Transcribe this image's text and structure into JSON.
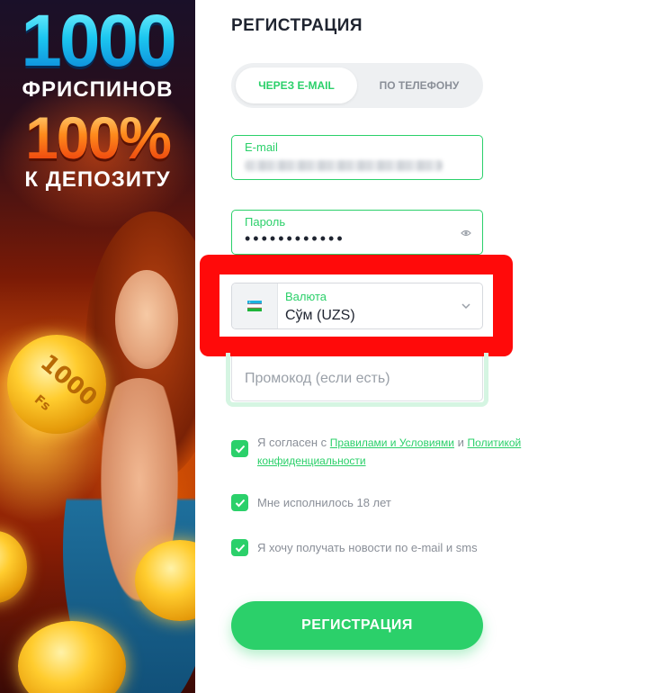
{
  "banner": {
    "line1": "1000",
    "line2": "ФРИСПИНОВ",
    "line3": "100%",
    "line4": "К ДЕПОЗИТУ",
    "coin_text": "1000",
    "coin_sub": "Fs"
  },
  "form": {
    "title": "РЕГИСТРАЦИЯ",
    "tabs": [
      {
        "label": "ЧЕРЕЗ E-MAIL",
        "active": true
      },
      {
        "label": "ПО ТЕЛЕФОНУ",
        "active": false
      }
    ],
    "email": {
      "label": "E-mail"
    },
    "password": {
      "label": "Пароль",
      "value": "••••••••••••"
    },
    "currency": {
      "label": "Валюта",
      "value": "Сўм (UZS)",
      "flag": "uzbekistan-flag-icon"
    },
    "promocode": {
      "placeholder": "Промокод (если есть)"
    },
    "checks": {
      "terms_prefix": "Я согласен с",
      "terms_link": "Правилами и Условиями",
      "terms_and": "и",
      "privacy_link_1": "Политикой",
      "privacy_link_2": "конфиденциальности",
      "age": "Мне исполнилось 18 лет",
      "news": "Я хочу получать новости по e-mail и sms"
    },
    "submit_label": "РЕГИСТРАЦИЯ"
  },
  "colors": {
    "accent": "#2bd06a",
    "highlight": "#ff0a0a"
  }
}
